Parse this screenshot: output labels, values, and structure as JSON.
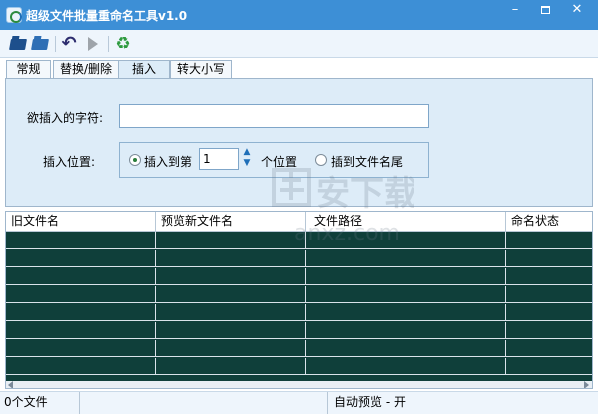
{
  "window": {
    "title": "超级文件批量重命名工具v1.0",
    "min_glyph": "–",
    "close_glyph": "✕"
  },
  "toolbar": {
    "icons": [
      "open-folder-icon",
      "open-files-icon",
      "undo-icon",
      "run-icon",
      "recycle-icon"
    ],
    "undo_glyph": "↶",
    "recycle_glyph": "♻"
  },
  "tabs": [
    {
      "label": "常规",
      "active": false
    },
    {
      "label": "替换/删除",
      "active": false
    },
    {
      "label": "插入",
      "active": true
    },
    {
      "label": "转大小写",
      "active": false
    }
  ],
  "insert_panel": {
    "chars_label": "欲插入的字符:",
    "chars_value": "",
    "position_label": "插入位置:",
    "option_at_index_label": "插入到第",
    "option_at_index_checked": true,
    "index_value": "1",
    "index_unit": "个位置",
    "option_at_end_label": "插到文件名尾",
    "option_at_end_checked": false
  },
  "grid": {
    "columns": [
      "旧文件名",
      "预览新文件名",
      "文件路径",
      "命名状态"
    ],
    "rows": [
      [
        "",
        "",
        "",
        ""
      ],
      [
        "",
        "",
        "",
        ""
      ],
      [
        "",
        "",
        "",
        ""
      ],
      [
        "",
        "",
        "",
        ""
      ],
      [
        "",
        "",
        "",
        ""
      ],
      [
        "",
        "",
        "",
        ""
      ],
      [
        "",
        "",
        "",
        ""
      ],
      [
        "",
        "",
        "",
        ""
      ]
    ],
    "background_color": "#0f3f3a"
  },
  "watermark": {
    "title": "安下载",
    "subtitle": "anxz.com"
  },
  "status": {
    "file_count": "0个文件",
    "middle": "",
    "auto_preview": "自动预览 - 开"
  },
  "colors": {
    "titlebar": "#3d8fd6",
    "panel": "#ddecf8",
    "grid_body": "#0f3f3a"
  }
}
